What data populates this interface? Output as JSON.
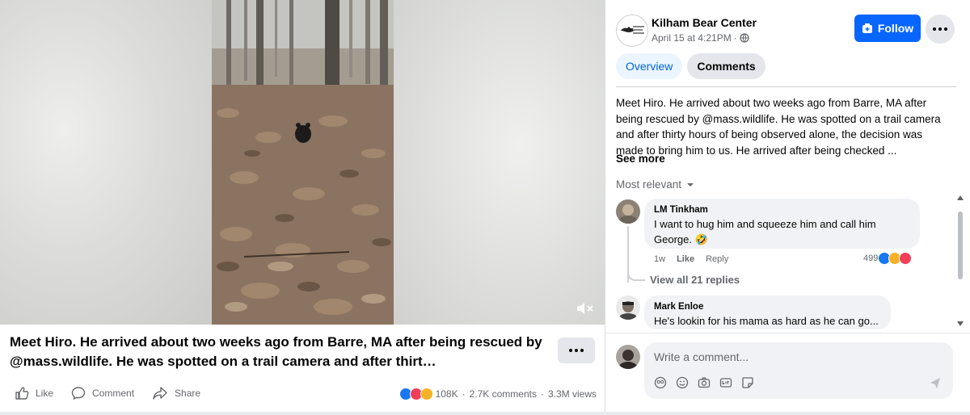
{
  "video": {
    "caption": "Meet Hiro. He arrived about two weeks ago from Barre, MA after being rescued by @mass.wildlife. He was spotted on a trail camera and after thirt…",
    "mute_icon": "speaker-muted-icon"
  },
  "actions": {
    "like": "Like",
    "comment": "Comment",
    "share": "Share"
  },
  "stats": {
    "reactions_count": "108K",
    "comments": "2.7K comments",
    "views": "3.3M views",
    "separator": "·"
  },
  "post": {
    "page_name": "Kilham Bear Center",
    "date": "April 15 at 4:21PM",
    "separator": "·",
    "follow_label": "Follow",
    "tabs": [
      "Overview",
      "Comments"
    ],
    "description": "Meet Hiro. He arrived about two weeks ago from Barre, MA after being rescued by @mass.wildlife. He was spotted on a trail camera and after thirty hours of being observed alone, the decision was made to bring him to us. He arrived after being checked ...",
    "see_more": "See more",
    "sort_label": "Most relevant"
  },
  "comments": [
    {
      "author": "LM Tinkham",
      "text": "I want to hug him and squeeze him and call him George. 🤣",
      "age": "1w",
      "like": "Like",
      "reply": "Reply",
      "reaction_count": "499",
      "view_replies": "View all 21 replies"
    },
    {
      "author": "Mark Enloe",
      "text": "He's lookin for his mama as hard as he can go..."
    }
  ],
  "composer": {
    "placeholder": "Write a comment..."
  },
  "colors": {
    "brand_blue": "#0866ff",
    "tab_active_bg": "#ebf5ff",
    "text_secondary": "#65676b"
  }
}
